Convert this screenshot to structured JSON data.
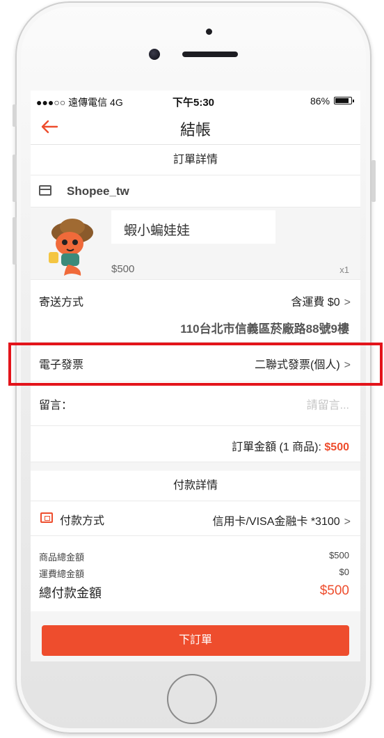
{
  "status_bar": {
    "carrier": "●●●○○ 遠傳電信  4G",
    "time": "下午5:30",
    "battery": "86%"
  },
  "nav": {
    "back_icon": "arrow-left",
    "title": "結帳"
  },
  "order": {
    "section_title": "訂單詳情",
    "shop_icon": "store-icon",
    "shop_name": "Shopee_tw",
    "product": {
      "name": "蝦小蝙娃娃",
      "price": "$500",
      "quantity": "x1"
    },
    "shipping": {
      "label": "寄送方式",
      "value": "含運費  $0",
      "address": "110台北市信義區菸廠路88號9樓"
    },
    "invoice": {
      "label": "電子發票",
      "value": "二聯式發票(個人)"
    },
    "message": {
      "label": "留言：",
      "placeholder": "請留言..."
    },
    "total": {
      "label": "訂單金額 (1 商品): ",
      "amount": "$500"
    }
  },
  "payment": {
    "section_title": "付款詳情",
    "method_label": "付款方式",
    "method_value": "信用卡/VISA金融卡  *3100",
    "items_label": "商品總金額",
    "items_value": "$500",
    "shipping_label": "運費總金額",
    "shipping_value": "$0",
    "grand_label": "總付款金額",
    "grand_value": "$500"
  },
  "actions": {
    "place_order": "下訂單"
  },
  "colors": {
    "accent": "#ee4d2d",
    "highlight": "#e3141b"
  }
}
